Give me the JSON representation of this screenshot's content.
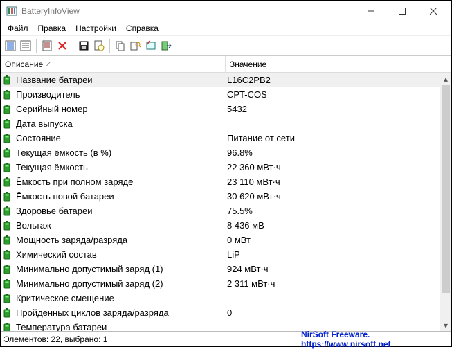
{
  "window": {
    "title": "BatteryInfoView"
  },
  "menu": {
    "file": "Файл",
    "edit": "Правка",
    "settings": "Настройки",
    "help": "Справка"
  },
  "columns": {
    "description": "Описание",
    "value": "Значение"
  },
  "rows": [
    {
      "desc": "Название батареи",
      "val": "L16C2PB2",
      "selected": true
    },
    {
      "desc": "Производитель",
      "val": "CPT-COS"
    },
    {
      "desc": "Серийный номер",
      "val": " 5432"
    },
    {
      "desc": "Дата выпуска",
      "val": ""
    },
    {
      "desc": "Состояние",
      "val": "Питание от сети"
    },
    {
      "desc": "Текущая ёмкость (в %)",
      "val": "96.8%"
    },
    {
      "desc": "Текущая ёмкость",
      "val": "22 360 мВт·ч"
    },
    {
      "desc": "Ёмкость при полном заряде",
      "val": "23 110 мВт·ч"
    },
    {
      "desc": "Ёмкость новой батареи",
      "val": "30 620 мВт·ч"
    },
    {
      "desc": "Здоровье батареи",
      "val": "75.5%"
    },
    {
      "desc": "Вольтаж",
      "val": "8 436 мВ"
    },
    {
      "desc": "Мощность заряда/разряда",
      "val": "0 мВт"
    },
    {
      "desc": "Химический состав",
      "val": "LiP"
    },
    {
      "desc": "Минимально допустимый заряд (1)",
      "val": "924 мВт·ч"
    },
    {
      "desc": "Минимально допустимый заряд (2)",
      "val": "2 311 мВт·ч"
    },
    {
      "desc": "Критическое смещение",
      "val": ""
    },
    {
      "desc": "Пройденных циклов заряда/разряда",
      "val": "0"
    },
    {
      "desc": "Температура батареи",
      "val": ""
    }
  ],
  "status": {
    "left": "Элементов: 22, выбрано: 1",
    "right": "NirSoft Freeware. https://www.nirsoft.net"
  }
}
